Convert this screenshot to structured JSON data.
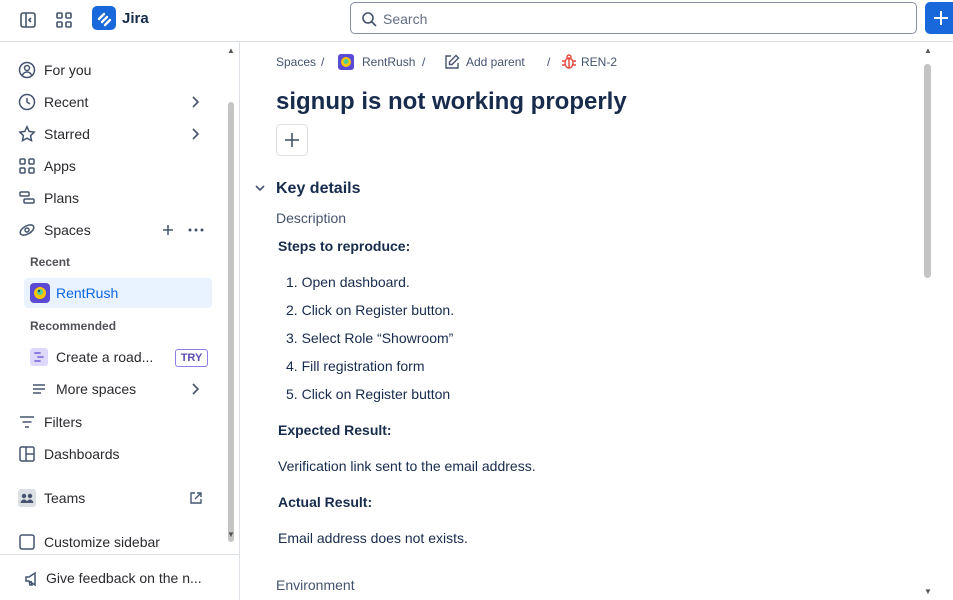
{
  "topbar": {
    "app_name": "Jira",
    "search_placeholder": "Search",
    "icons": [
      "sidebar-toggle-icon",
      "app-switcher-icon",
      "jira-logo",
      "search-icon",
      "plus-icon"
    ]
  },
  "sidebar": {
    "items": [
      {
        "label": "For you",
        "icon": "person-icon"
      },
      {
        "label": "Recent",
        "icon": "clock-icon"
      },
      {
        "label": "Starred",
        "icon": "star-icon"
      },
      {
        "label": "Apps",
        "icon": "apps-icon"
      },
      {
        "label": "Plans",
        "icon": "plans-icon"
      },
      {
        "label": "Spaces",
        "icon": "spaces-icon"
      }
    ],
    "recent_heading": "Recent",
    "recent_project": "RentRush",
    "recommended_heading": "Recommended",
    "roadmap_label": "Create a road...",
    "try_badge": "TRY",
    "more_spaces": "More spaces",
    "filters": "Filters",
    "dashboards": "Dashboards",
    "teams": "Teams",
    "customize": "Customize sidebar",
    "feedback": "Give feedback on the n..."
  },
  "breadcrumb": {
    "spaces": "Spaces",
    "sep": "/",
    "project": "RentRush",
    "add_parent": "Add parent",
    "issue_key": "REN-2"
  },
  "issue": {
    "title": "signup is not working properly",
    "key_details": "Key details",
    "description_label": "Description",
    "steps_heading": "Steps to reproduce:",
    "steps": [
      "Open dashboard.",
      "Click on Register button.",
      "Select Role “Showroom”",
      "Fill registration form",
      "Click on Register button"
    ],
    "expected_heading": "Expected Result:",
    "expected_text": "Verification link sent to the email address.",
    "actual_heading": "Actual Result:",
    "actual_text": "Email address does not exists.",
    "environment_label": "Environment"
  },
  "colors": {
    "accent": "#1868db",
    "active_bg": "#e9f2ff",
    "bug_red": "#e2483d"
  }
}
